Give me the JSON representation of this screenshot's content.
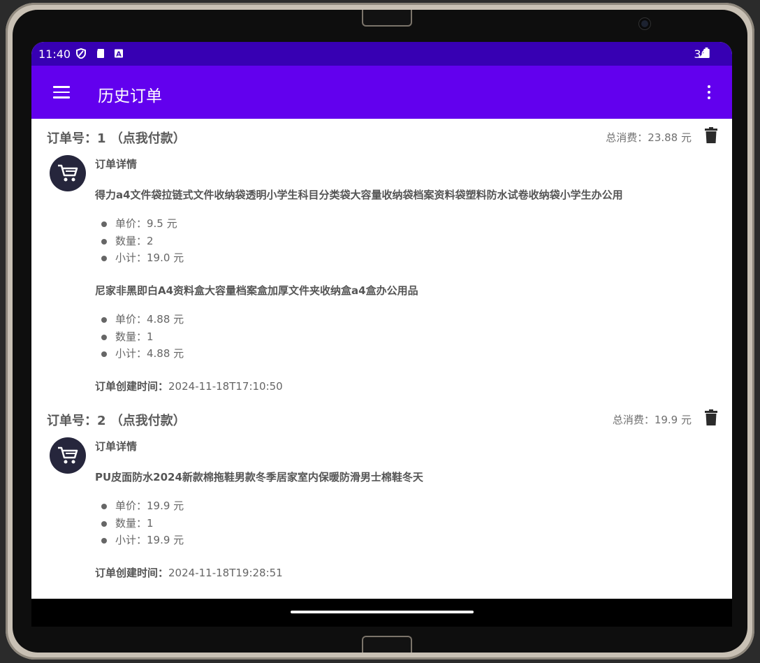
{
  "status_bar": {
    "time": "11:40",
    "network": "3G"
  },
  "app_bar": {
    "title": "历史订单"
  },
  "orders": [
    {
      "order_label": "订单号：1",
      "pay_label": "（点我付款）",
      "total": "总消费：23.88 元",
      "detail_title": "订单详情",
      "items": [
        {
          "name": "得力a4文件袋拉链式文件收纳袋透明小学生科目分类袋大容量收纳袋档案资料袋塑料防水试卷收纳袋小学生办公用",
          "unit_price": "单价：9.5 元",
          "quantity": "数量：2",
          "subtotal": "小计：19.0 元"
        },
        {
          "name": "尼家非黑即白A4资料盒大容量档案盒加厚文件夹收纳盒a4盒办公用品",
          "unit_price": "单价：4.88 元",
          "quantity": "数量：1",
          "subtotal": "小计：4.88 元"
        }
      ],
      "created_label": "订单创建时间：",
      "created_value": "2024-11-18T17:10:50"
    },
    {
      "order_label": "订单号：2",
      "pay_label": "（点我付款）",
      "total": "总消费：19.9 元",
      "detail_title": "订单详情",
      "items": [
        {
          "name": "PU皮面防水2024新款棉拖鞋男款冬季居家室内保暖防滑男士棉鞋冬天",
          "unit_price": "单价：19.9 元",
          "quantity": "数量：1",
          "subtotal": "小计：19.9 元"
        }
      ],
      "created_label": "订单创建时间：",
      "created_value": "2024-11-18T19:28:51"
    }
  ],
  "colors": {
    "status_bar": "#3700b3",
    "app_bar": "#6200ee",
    "avatar_bg": "#26263c"
  },
  "icons": [
    "menu-icon",
    "overflow-menu-icon",
    "trash-icon",
    "shopping-cart-icon"
  ]
}
